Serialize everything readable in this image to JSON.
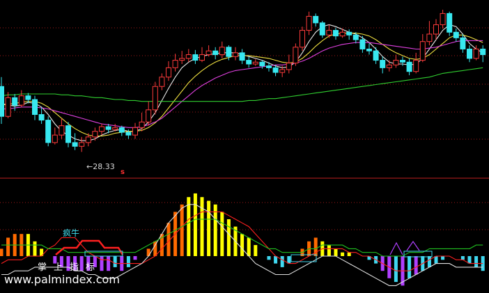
{
  "annotations": {
    "low_price_label": "←28.33",
    "signal_mark": "s",
    "indicator_label": "疯牛"
  },
  "watermark": {
    "site_name": "掌上指标",
    "url": "www.palmindex.com"
  },
  "colors": {
    "background": "#000000",
    "up_candle": "#ff3b3b",
    "down_candle": "#38e8f0",
    "ma_white": "#e8e8e8",
    "ma_yellow": "#f0e040",
    "ma_magenta": "#e040e0",
    "ma_green": "#30d030",
    "grid": "#a01818",
    "separator": "#c02020",
    "bar_orange": "#ff6a00",
    "bar_yellow": "#ffff00",
    "bar_cyan": "#40d8f0",
    "bar_purple": "#b040ff",
    "osc_red": "#ff2020",
    "osc_white": "#e0e0e0",
    "osc_green": "#20c020"
  },
  "chart_data": [
    {
      "type": "candlestick",
      "title": "",
      "low_label_value": 28.33,
      "candles": [
        [
          0.7,
          0.38,
          0.8,
          0.3
        ],
        [
          0.38,
          0.58,
          0.64,
          0.36
        ],
        [
          0.58,
          0.5,
          0.62,
          0.44
        ],
        [
          0.5,
          0.6,
          0.66,
          0.48
        ],
        [
          0.6,
          0.56,
          0.63,
          0.52
        ],
        [
          0.56,
          0.4,
          0.6,
          0.34
        ],
        [
          0.4,
          0.34,
          0.48,
          0.3
        ],
        [
          0.34,
          0.1,
          0.38,
          0.06
        ],
        [
          0.1,
          0.18,
          0.26,
          0.08
        ],
        [
          0.18,
          0.28,
          0.36,
          0.14
        ],
        [
          0.28,
          0.1,
          0.32,
          0.05
        ],
        [
          0.1,
          0.06,
          0.2,
          0.02
        ],
        [
          0.06,
          0.1,
          0.16,
          0.0
        ],
        [
          0.1,
          0.16,
          0.2,
          0.06
        ],
        [
          0.16,
          0.22,
          0.26,
          0.12
        ],
        [
          0.22,
          0.27,
          0.3,
          0.18
        ],
        [
          0.27,
          0.24,
          0.3,
          0.2
        ],
        [
          0.24,
          0.26,
          0.3,
          0.22
        ],
        [
          0.26,
          0.21,
          0.28,
          0.17
        ],
        [
          0.21,
          0.18,
          0.24,
          0.14
        ],
        [
          0.18,
          0.26,
          0.31,
          0.14
        ],
        [
          0.26,
          0.32,
          0.42,
          0.22
        ],
        [
          0.32,
          0.45,
          0.54,
          0.28
        ],
        [
          0.45,
          0.7,
          0.75,
          0.4
        ],
        [
          0.7,
          0.8,
          0.84,
          0.66
        ],
        [
          0.8,
          0.9,
          0.97,
          0.76
        ],
        [
          0.9,
          0.98,
          1.05,
          0.86
        ],
        [
          0.98,
          1.0,
          1.08,
          0.94
        ],
        [
          1.0,
          1.04,
          1.1,
          0.96
        ],
        [
          1.04,
          0.98,
          1.09,
          0.94
        ],
        [
          0.98,
          1.04,
          1.12,
          0.96
        ],
        [
          1.04,
          1.08,
          1.14,
          1.02
        ],
        [
          1.08,
          1.04,
          1.12,
          0.99
        ],
        [
          1.04,
          1.12,
          1.18,
          1.0
        ],
        [
          1.12,
          1.02,
          1.14,
          0.98
        ],
        [
          1.02,
          1.06,
          1.12,
          0.98
        ],
        [
          1.06,
          0.98,
          1.1,
          0.94
        ],
        [
          0.98,
          0.94,
          1.02,
          0.9
        ],
        [
          0.94,
          0.96,
          0.99,
          0.92
        ],
        [
          0.96,
          0.92,
          0.98,
          0.89
        ],
        [
          0.92,
          0.9,
          0.96,
          0.86
        ],
        [
          0.9,
          0.85,
          0.93,
          0.81
        ],
        [
          0.85,
          0.88,
          0.92,
          0.8
        ],
        [
          0.88,
          0.95,
          1.04,
          0.84
        ],
        [
          0.95,
          1.12,
          1.16,
          0.92
        ],
        [
          1.12,
          1.3,
          1.34,
          1.08
        ],
        [
          1.3,
          1.45,
          1.5,
          1.25
        ],
        [
          1.45,
          1.38,
          1.48,
          1.34
        ],
        [
          1.38,
          1.25,
          1.4,
          1.22
        ],
        [
          1.25,
          1.3,
          1.36,
          1.22
        ],
        [
          1.3,
          1.24,
          1.33,
          1.2
        ],
        [
          1.24,
          1.28,
          1.32,
          1.22
        ],
        [
          1.28,
          1.25,
          1.31,
          1.2
        ],
        [
          1.25,
          1.2,
          1.28,
          1.16
        ],
        [
          1.2,
          1.1,
          1.24,
          1.06
        ],
        [
          1.1,
          1.08,
          1.16,
          1.04
        ],
        [
          1.08,
          0.98,
          1.12,
          0.94
        ],
        [
          0.98,
          0.9,
          1.02,
          0.84
        ],
        [
          0.9,
          0.93,
          0.98,
          0.86
        ],
        [
          0.93,
          0.98,
          1.04,
          0.9
        ],
        [
          0.98,
          0.96,
          1.02,
          0.92
        ],
        [
          0.96,
          0.86,
          1.0,
          0.82
        ],
        [
          0.86,
          0.98,
          1.06,
          0.84
        ],
        [
          0.98,
          1.18,
          1.26,
          0.96
        ],
        [
          1.18,
          1.26,
          1.4,
          1.14
        ],
        [
          1.26,
          1.36,
          1.42,
          1.2
        ],
        [
          1.36,
          1.48,
          1.52,
          1.32
        ],
        [
          1.48,
          1.28,
          1.5,
          1.24
        ],
        [
          1.28,
          1.22,
          1.32,
          1.18
        ],
        [
          1.22,
          1.1,
          1.26,
          1.06
        ],
        [
          1.1,
          1.0,
          1.14,
          0.96
        ],
        [
          1.0,
          1.1,
          1.14,
          0.98
        ],
        [
          1.1,
          1.04,
          1.14,
          0.96
        ]
      ],
      "moving_averages": [
        {
          "color_key": "ma_white",
          "values": [
            0.52,
            0.5,
            0.49,
            0.5,
            0.53,
            0.52,
            0.48,
            0.4,
            0.3,
            0.22,
            0.18,
            0.14,
            0.12,
            0.12,
            0.14,
            0.18,
            0.21,
            0.23,
            0.24,
            0.22,
            0.22,
            0.25,
            0.32,
            0.42,
            0.55,
            0.68,
            0.8,
            0.9,
            0.96,
            1.0,
            1.02,
            1.04,
            1.05,
            1.06,
            1.06,
            1.06,
            1.04,
            1.02,
            1.0,
            0.98,
            0.95,
            0.92,
            0.9,
            0.91,
            0.96,
            1.06,
            1.18,
            1.28,
            1.34,
            1.36,
            1.34,
            1.31,
            1.28,
            1.26,
            1.22,
            1.17,
            1.1,
            1.02,
            0.96,
            0.94,
            0.94,
            0.93,
            0.94,
            1.0,
            1.1,
            1.2,
            1.3,
            1.36,
            1.34,
            1.26,
            1.16,
            1.1,
            1.06
          ]
        },
        {
          "color_key": "ma_yellow",
          "values": [
            0.5,
            0.51,
            0.52,
            0.53,
            0.54,
            0.54,
            0.52,
            0.48,
            0.42,
            0.36,
            0.3,
            0.25,
            0.21,
            0.18,
            0.17,
            0.17,
            0.18,
            0.2,
            0.21,
            0.22,
            0.22,
            0.23,
            0.26,
            0.31,
            0.38,
            0.47,
            0.56,
            0.65,
            0.74,
            0.81,
            0.87,
            0.92,
            0.96,
            0.99,
            1.01,
            1.03,
            1.03,
            1.03,
            1.02,
            1.01,
            1.0,
            0.98,
            0.96,
            0.95,
            0.96,
            1.0,
            1.06,
            1.13,
            1.19,
            1.24,
            1.26,
            1.27,
            1.27,
            1.27,
            1.26,
            1.24,
            1.2,
            1.15,
            1.1,
            1.06,
            1.03,
            1.0,
            0.99,
            1.0,
            1.04,
            1.1,
            1.16,
            1.22,
            1.25,
            1.25,
            1.23,
            1.2,
            1.17
          ]
        },
        {
          "color_key": "ma_magenta",
          "values": [
            0.46,
            0.46,
            0.47,
            0.48,
            0.48,
            0.48,
            0.47,
            0.46,
            0.44,
            0.42,
            0.4,
            0.38,
            0.36,
            0.34,
            0.32,
            0.3,
            0.29,
            0.28,
            0.27,
            0.26,
            0.26,
            0.27,
            0.29,
            0.32,
            0.36,
            0.42,
            0.48,
            0.54,
            0.6,
            0.66,
            0.71,
            0.75,
            0.79,
            0.82,
            0.85,
            0.87,
            0.88,
            0.89,
            0.9,
            0.91,
            0.92,
            0.93,
            0.93,
            0.94,
            0.95,
            0.97,
            1.0,
            1.04,
            1.08,
            1.11,
            1.13,
            1.15,
            1.16,
            1.17,
            1.17,
            1.17,
            1.16,
            1.15,
            1.14,
            1.13,
            1.12,
            1.11,
            1.1,
            1.1,
            1.11,
            1.12,
            1.14,
            1.16,
            1.18,
            1.19,
            1.19,
            1.19,
            1.19
          ]
        },
        {
          "color_key": "ma_green",
          "values": [
            0.6,
            0.61,
            0.61,
            0.62,
            0.62,
            0.62,
            0.62,
            0.62,
            0.62,
            0.61,
            0.61,
            0.6,
            0.6,
            0.59,
            0.58,
            0.58,
            0.57,
            0.56,
            0.56,
            0.55,
            0.55,
            0.54,
            0.54,
            0.54,
            0.54,
            0.54,
            0.54,
            0.54,
            0.54,
            0.54,
            0.54,
            0.54,
            0.54,
            0.54,
            0.54,
            0.54,
            0.54,
            0.55,
            0.55,
            0.56,
            0.57,
            0.57,
            0.58,
            0.59,
            0.6,
            0.61,
            0.62,
            0.63,
            0.64,
            0.65,
            0.66,
            0.67,
            0.68,
            0.69,
            0.7,
            0.71,
            0.72,
            0.73,
            0.74,
            0.75,
            0.76,
            0.77,
            0.78,
            0.79,
            0.8,
            0.82,
            0.84,
            0.85,
            0.86,
            0.87,
            0.88,
            0.89,
            0.9
          ]
        }
      ]
    },
    {
      "type": "bar",
      "title": "",
      "values": [
        2,
        5,
        6,
        6,
        6,
        4,
        2,
        0,
        -2,
        -3,
        -4,
        -4,
        -4,
        -4,
        -3,
        -4,
        -4,
        -3,
        -4,
        -3,
        -1,
        0,
        2,
        4,
        6,
        9,
        12,
        14,
        16,
        17,
        16,
        15,
        14,
        12,
        10,
        8,
        6,
        5,
        3,
        0,
        -1,
        -2,
        -3,
        -2,
        0,
        2,
        4,
        5,
        4,
        3,
        2,
        1,
        1,
        0,
        0,
        -1,
        -2,
        -4,
        -6,
        -7,
        -8,
        -6,
        -5,
        -4,
        -3,
        -2,
        -1,
        0,
        0,
        -1,
        -2,
        -3,
        -4
      ],
      "bar_colors": [
        "orange",
        "orange",
        "orange",
        "orange",
        "yellow",
        "yellow",
        "yellow",
        "none",
        "purple",
        "purple",
        "purple",
        "purple",
        "purple",
        "purple",
        "purple",
        "purple",
        "purple",
        "cyan",
        "purple",
        "cyan",
        "purple",
        "none",
        "orange",
        "orange",
        "orange",
        "orange",
        "orange",
        "orange",
        "yellow",
        "yellow",
        "yellow",
        "yellow",
        "yellow",
        "yellow",
        "yellow",
        "yellow",
        "yellow",
        "yellow",
        "yellow",
        "none",
        "cyan",
        "cyan",
        "cyan",
        "cyan",
        "none",
        "orange",
        "orange",
        "orange",
        "yellow",
        "yellow",
        "yellow",
        "yellow",
        "yellow",
        "none",
        "none",
        "cyan",
        "cyan",
        "purple",
        "purple",
        "cyan",
        "purple",
        "cyan",
        "purple",
        "cyan",
        "cyan",
        "cyan",
        "cyan",
        "none",
        "none",
        "cyan",
        "cyan",
        "cyan",
        "cyan"
      ],
      "lines": [
        {
          "color_key": "osc_red",
          "values": [
            -2,
            -1,
            -1,
            -1,
            0,
            0,
            0,
            2,
            3,
            5,
            5,
            5,
            3,
            1,
            0,
            -1,
            -1,
            -2,
            -2,
            -2,
            -2,
            -2,
            -1,
            0,
            2,
            4,
            6,
            8,
            10,
            11,
            12,
            12,
            12,
            12,
            11,
            10,
            9,
            8,
            6,
            4,
            2,
            0,
            -1,
            -2,
            -2,
            -1,
            0,
            1,
            2,
            2,
            2,
            2,
            1,
            1,
            0,
            0,
            -1,
            -2,
            -3,
            -4,
            -4,
            -4,
            -3,
            -2,
            -1,
            0,
            0,
            0,
            -1,
            -1,
            -2,
            -2,
            -2
          ]
        },
        {
          "color_key": "osc_white",
          "values": [
            -5,
            -5,
            -4,
            -4,
            -4,
            -3,
            -3,
            -3,
            -3,
            -3,
            -3,
            -4,
            -4,
            -5,
            -5,
            -6,
            -6,
            -6,
            -5,
            -4,
            -3,
            -2,
            0,
            3,
            6,
            9,
            11,
            13,
            14,
            14,
            13,
            12,
            10,
            8,
            6,
            4,
            2,
            0,
            -2,
            -3,
            -4,
            -5,
            -5,
            -5,
            -4,
            -3,
            -2,
            -1,
            0,
            0,
            0,
            -1,
            -2,
            -3,
            -4,
            -5,
            -6,
            -7,
            -8,
            -8,
            -7,
            -6,
            -5,
            -4,
            -3,
            -2,
            -2,
            -2,
            -3,
            -3,
            -3,
            -3,
            -3
          ]
        },
        {
          "color_key": "osc_green",
          "values": [
            3,
            3,
            3,
            3,
            3,
            3,
            3,
            2,
            2,
            2,
            1,
            1,
            1,
            1,
            1,
            1,
            1,
            1,
            1,
            1,
            1,
            2,
            3,
            4,
            5,
            6,
            7,
            8,
            9,
            10,
            10,
            10,
            10,
            9,
            8,
            7,
            6,
            5,
            4,
            3,
            2,
            2,
            1,
            1,
            1,
            1,
            2,
            2,
            3,
            3,
            3,
            3,
            2,
            2,
            1,
            1,
            1,
            0,
            0,
            0,
            0,
            1,
            1,
            1,
            2,
            2,
            2,
            2,
            2,
            2,
            2,
            3,
            3
          ]
        }
      ]
    }
  ]
}
